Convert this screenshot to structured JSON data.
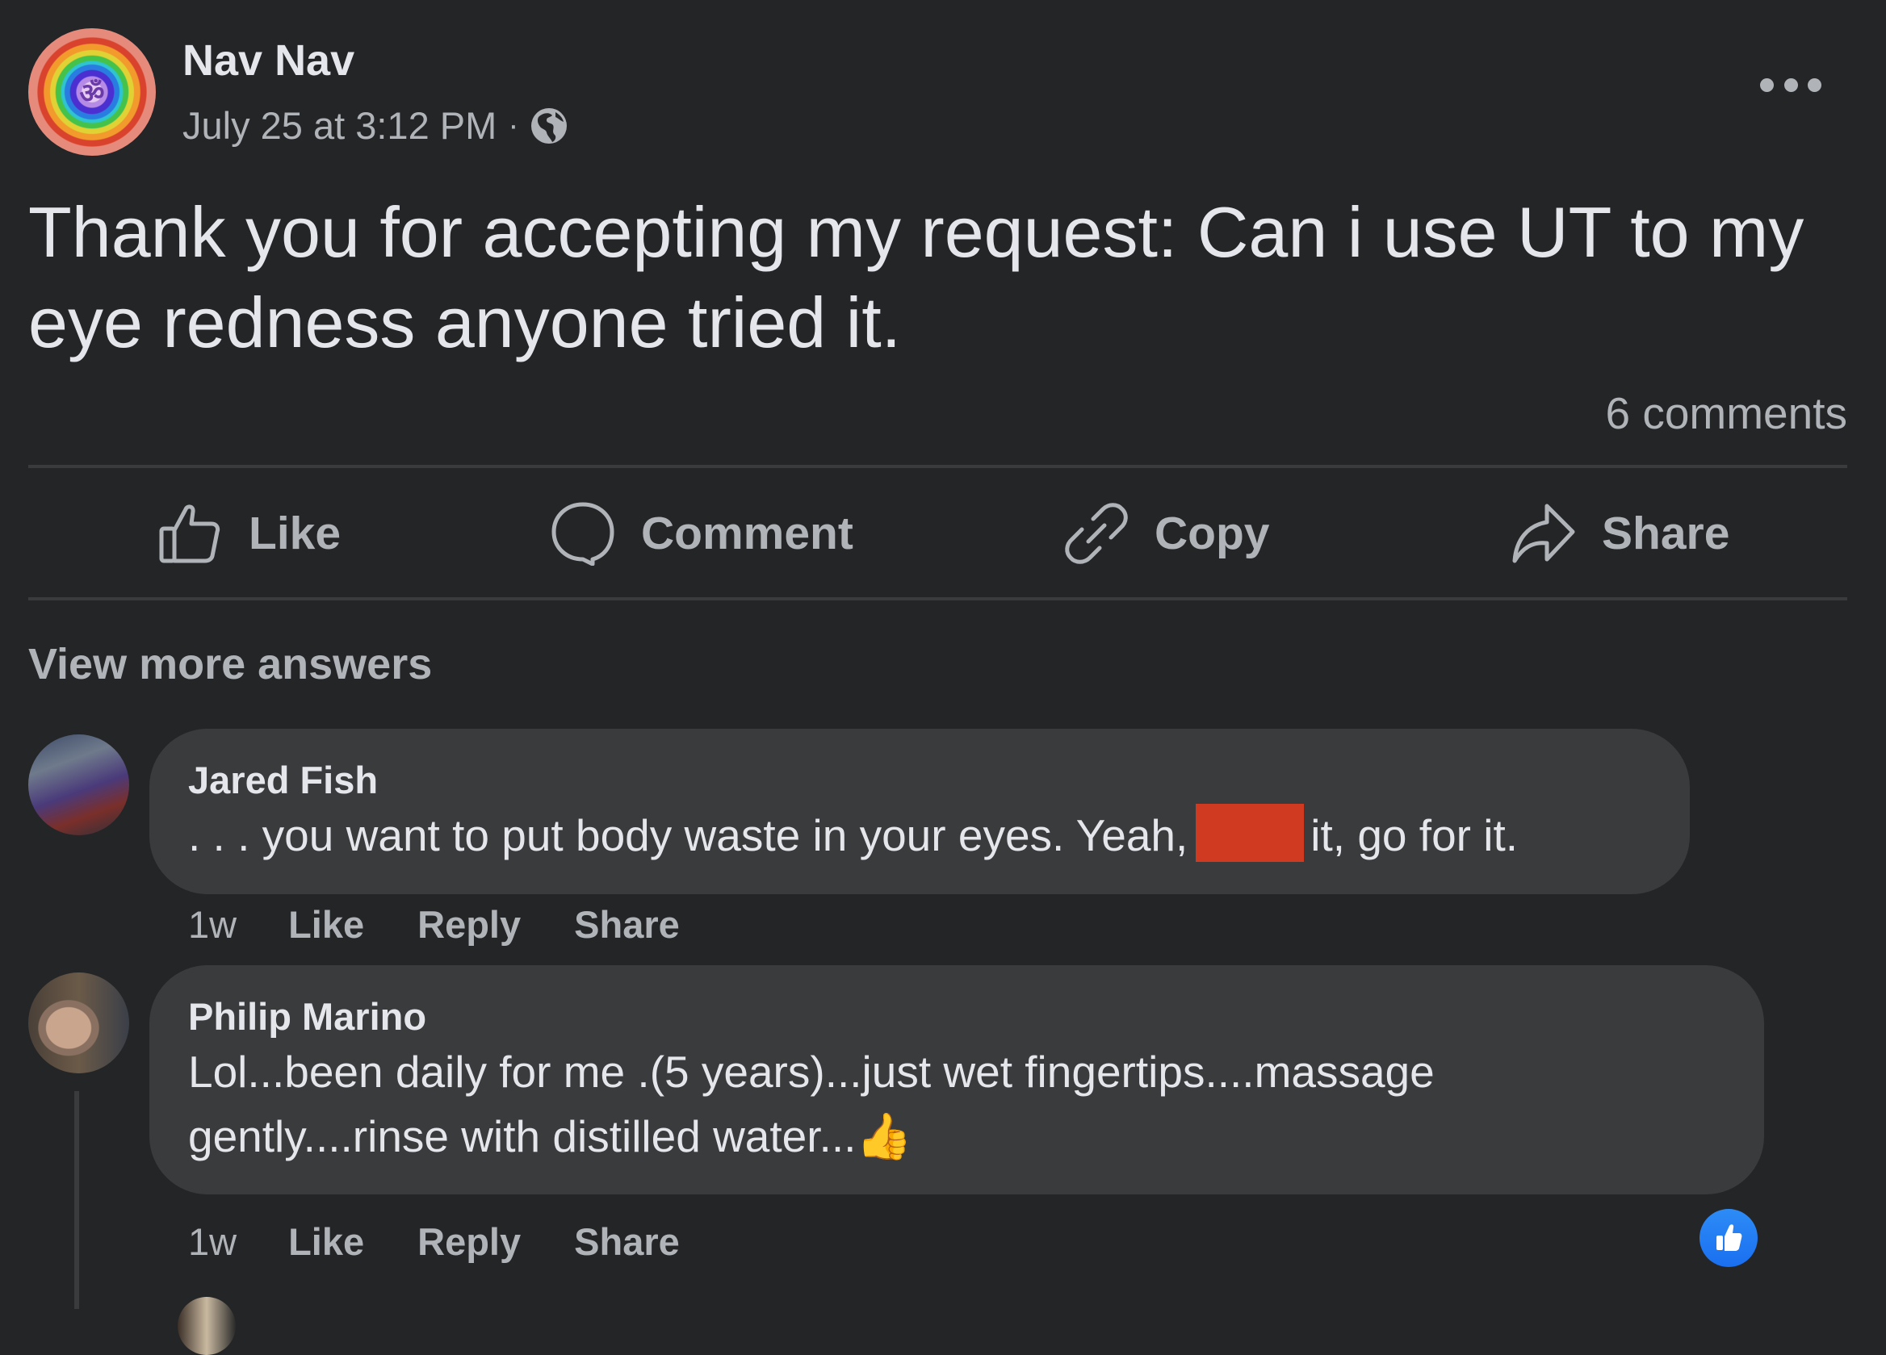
{
  "post": {
    "author": "Nav Nav",
    "avatar_glyph": "ॐ",
    "timestamp": "July 25 at 3:12 PM",
    "separator": "·",
    "audience_icon": "globe-icon",
    "menu_icon": "more-horizontal-icon",
    "text": "Thank you for accepting my request: Can i use UT to my eye redness anyone tried it.",
    "comments_count": "6 comments"
  },
  "actions": [
    {
      "label": "Like",
      "icon": "thumbs-up-outline-icon"
    },
    {
      "label": "Comment",
      "icon": "speech-bubble-icon"
    },
    {
      "label": "Copy",
      "icon": "link-icon"
    },
    {
      "label": "Share",
      "icon": "share-arrow-icon"
    }
  ],
  "view_more": "View more answers",
  "comments": [
    {
      "author": "Jared Fish",
      "text_before": ". . . you want to put body waste in your eyes. Yeah,",
      "redacted": true,
      "redaction_color": "#cf3a21",
      "text_after": "it, go for it.",
      "time": "1w",
      "actions": [
        "Like",
        "Reply",
        "Share"
      ]
    },
    {
      "author": "Philip Marino",
      "text_line1": "Lol...been daily for me .(5 years)...just wet fingertips....massage",
      "text_line2": "gently....rinse with distilled water...",
      "emoji": "👍",
      "time": "1w",
      "actions": [
        "Like",
        "Reply",
        "Share"
      ],
      "reaction": "like",
      "reaction_color": "#1877f2"
    }
  ],
  "colors": {
    "background": "#242527",
    "bubble": "#3a3b3c",
    "primary_text": "#e4e6eb",
    "secondary_text": "#b0b3b8",
    "divider": "#3a3b3d"
  }
}
